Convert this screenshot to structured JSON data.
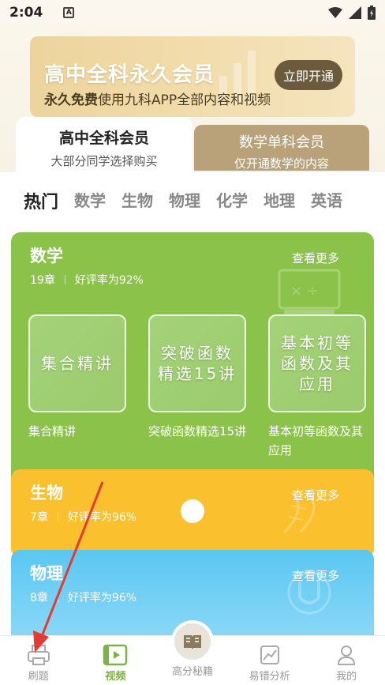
{
  "status_bar": {
    "time": "2:04",
    "notification_letter": "A"
  },
  "banner": {
    "title": "高中全科永久会员",
    "subtitle_bold": "永久免费",
    "subtitle_rest": "使用九科APP全部内容和视频",
    "button": "立即开通"
  },
  "tiers": [
    {
      "title": "高中全科会员",
      "desc": "大部分同学选择购买"
    },
    {
      "title": "数学单科会员",
      "desc": "仅开通数学的内容"
    }
  ],
  "subject_tabs": [
    "热门",
    "数学",
    "生物",
    "物理",
    "化学",
    "地理",
    "英语"
  ],
  "cards": {
    "math": {
      "title": "数学",
      "chapters": "19章",
      "rating": "好评率为92%",
      "more": "查看更多",
      "courses": [
        {
          "thumb": "集合精讲",
          "label": "集合精讲"
        },
        {
          "thumb": "突破函数精选15讲",
          "label": "突破函数精选15讲"
        },
        {
          "thumb": "基本初等函数及其应用",
          "label": "基本初等函数及其应用"
        }
      ]
    },
    "bio": {
      "title": "生物",
      "chapters": "7章",
      "rating": "好评率为96%",
      "more": "查看更多"
    },
    "phys": {
      "title": "物理",
      "chapters": "8章",
      "rating": "好评率为96%",
      "more": "查看更多"
    }
  },
  "bottom_nav": [
    "刷题",
    "视频",
    "高分秘籍",
    "易错分析",
    "我的"
  ],
  "colors": {
    "math": "#8bc34a",
    "bio": "#fbc02d",
    "phys": "#5ac7f2",
    "nav_active": "#7cb342",
    "arrow": "#e53935"
  }
}
